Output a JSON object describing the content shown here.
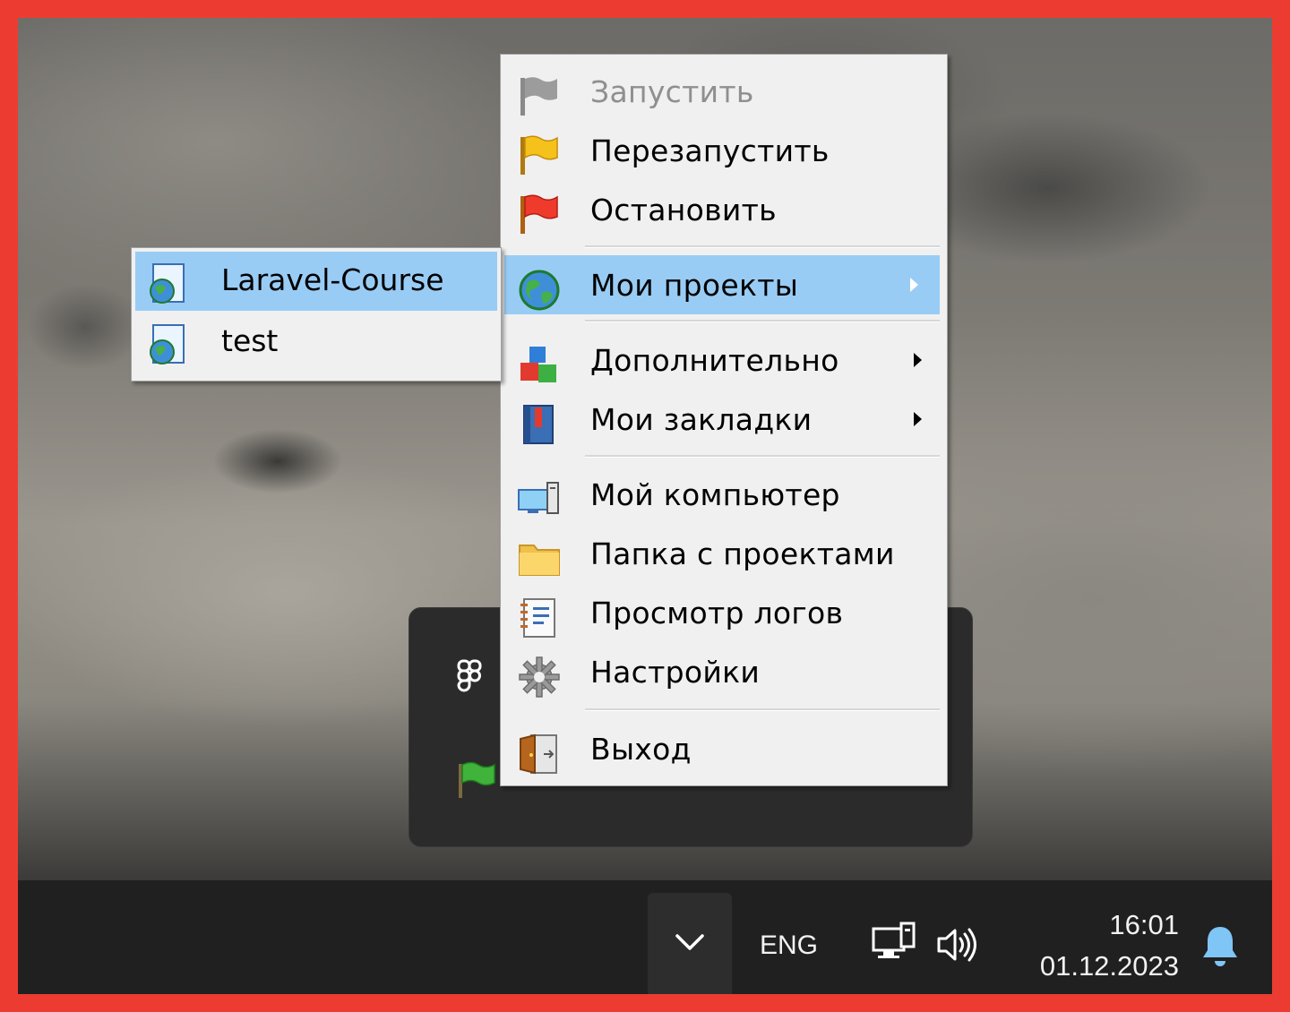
{
  "tray_menu": {
    "items": [
      {
        "label": "Запустить",
        "icon": "gray-flag-icon",
        "disabled": true
      },
      {
        "label": "Перезапустить",
        "icon": "yellow-flag-icon"
      },
      {
        "label": "Остановить",
        "icon": "red-flag-icon"
      },
      {
        "label": "Мои проекты",
        "icon": "globe-icon",
        "submenu": true,
        "highlighted": true
      },
      {
        "label": "Дополнительно",
        "icon": "blocks-icon",
        "submenu": true
      },
      {
        "label": "Мои закладки",
        "icon": "bookmark-book-icon",
        "submenu": true
      },
      {
        "label": "Мой компьютер",
        "icon": "computer-icon"
      },
      {
        "label": "Папка с проектами",
        "icon": "folder-icon"
      },
      {
        "label": "Просмотр логов",
        "icon": "log-notebook-icon"
      },
      {
        "label": "Настройки",
        "icon": "gear-icon"
      },
      {
        "label": "Выход",
        "icon": "exit-door-icon"
      }
    ]
  },
  "projects_submenu": {
    "items": [
      {
        "label": "Laravel-Course",
        "icon": "web-page-icon",
        "highlighted": true
      },
      {
        "label": "test",
        "icon": "web-page-icon"
      }
    ]
  },
  "taskbar": {
    "language": "ENG",
    "time": "16:01",
    "date": "01.12.2023"
  },
  "colors": {
    "highlight": "#99ccf5",
    "menu_bg": "#f0f0f0",
    "frame": "#ec3c32",
    "taskbar": "#202020"
  }
}
